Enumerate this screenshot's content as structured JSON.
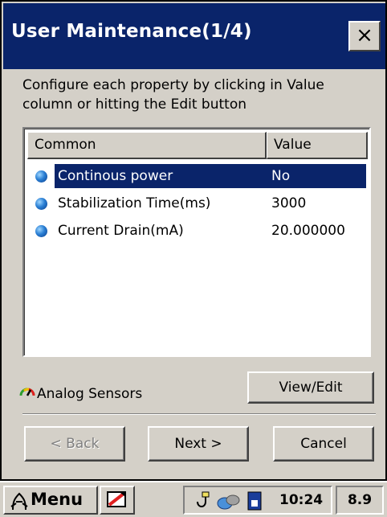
{
  "window": {
    "title": "User Maintenance(1/4)",
    "close_glyph": "×"
  },
  "instructions": "Configure each property by clicking in Value column or hitting the Edit button",
  "list": {
    "columns": [
      "Common",
      "Value"
    ],
    "rows": [
      {
        "name": "Continous power",
        "value": "No",
        "selected": true,
        "icon": "blue-bullet-icon"
      },
      {
        "name": "Stabilization Time(ms)",
        "value": "3000",
        "selected": false,
        "icon": "blue-bullet-icon"
      },
      {
        "name": "Current Drain(mA)",
        "value": "20.000000",
        "selected": false,
        "icon": "blue-bullet-icon"
      }
    ],
    "selection_color": "#0a246a"
  },
  "footer": {
    "section_icon": "analog-gauge-icon",
    "section_label": "Analog Sensors",
    "view_edit_label": "View/Edit"
  },
  "wizard": {
    "back_label": "< Back",
    "back_enabled": false,
    "next_label": "Next >",
    "cancel_label": "Cancel"
  },
  "taskbar": {
    "menu_label": "Menu",
    "menu_icon": "start-menu-icon",
    "sip_icon": "input-panel-icon",
    "tray_icons": [
      "usb-connection-icon",
      "network-icon",
      "storage-card-icon"
    ],
    "time": "10:24",
    "version": "8.9"
  },
  "colors": {
    "titlebar": "#0a246a",
    "face": "#d4d0c8"
  }
}
